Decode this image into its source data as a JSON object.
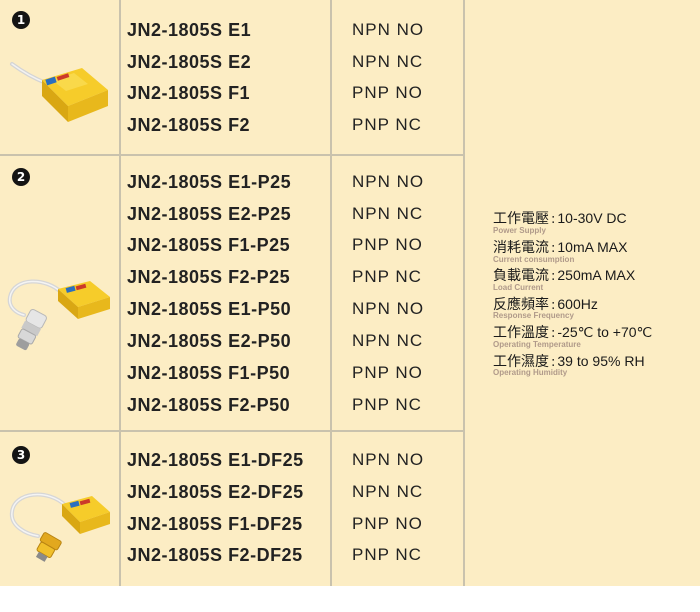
{
  "groups": [
    {
      "number": "1",
      "rows": [
        {
          "model": "JN2-1805S E1",
          "type": "NPN NO"
        },
        {
          "model": "JN2-1805S E2",
          "type": "NPN NC"
        },
        {
          "model": "JN2-1805S F1",
          "type": "PNP NO"
        },
        {
          "model": "JN2-1805S F2",
          "type": "PNP NC"
        }
      ]
    },
    {
      "number": "2",
      "rows": [
        {
          "model": "JN2-1805S E1-P25",
          "type": "NPN NO"
        },
        {
          "model": "JN2-1805S E2-P25",
          "type": "NPN NC"
        },
        {
          "model": "JN2-1805S F1-P25",
          "type": "PNP NO"
        },
        {
          "model": "JN2-1805S F2-P25",
          "type": "PNP NC"
        },
        {
          "model": "JN2-1805S E1-P50",
          "type": "NPN NO"
        },
        {
          "model": "JN2-1805S E2-P50",
          "type": "NPN NC"
        },
        {
          "model": "JN2-1805S F1-P50",
          "type": "PNP NO"
        },
        {
          "model": "JN2-1805S F2-P50",
          "type": "PNP NC"
        }
      ]
    },
    {
      "number": "3",
      "rows": [
        {
          "model": "JN2-1805S E1-DF25",
          "type": "NPN NO"
        },
        {
          "model": "JN2-1805S E2-DF25",
          "type": "NPN NC"
        },
        {
          "model": "JN2-1805S F1-DF25",
          "type": "PNP NO"
        },
        {
          "model": "JN2-1805S F2-DF25",
          "type": "PNP NC"
        }
      ]
    }
  ],
  "specs": [
    {
      "label": "工作電壓",
      "colon": ":",
      "value": "10-30V DC",
      "sublabel": "Power Supply"
    },
    {
      "label": "消耗電流",
      "colon": ":",
      "value": "10mA MAX",
      "sublabel": "Current consumption"
    },
    {
      "label": "負載電流",
      "colon": ":",
      "value": "250mA MAX",
      "sublabel": "Load Current"
    },
    {
      "label": "反應頻率",
      "colon": ":",
      "value": "600Hz",
      "sublabel": "Response Frequency"
    },
    {
      "label": "工作溫度",
      "colon": ":",
      "value": "-25℃ to +70℃",
      "sublabel": "Operating Temperature"
    },
    {
      "label": "工作濕度",
      "colon": ":",
      "value": "39 to 95% RH",
      "sublabel": "Operating Humidity"
    }
  ],
  "colors": {
    "background": "#fcedc4",
    "grid": "#c9c2ad",
    "sensor_body": "#f2c21a",
    "cable": "#dcdcdc",
    "sublabel": "#b09a8a"
  }
}
